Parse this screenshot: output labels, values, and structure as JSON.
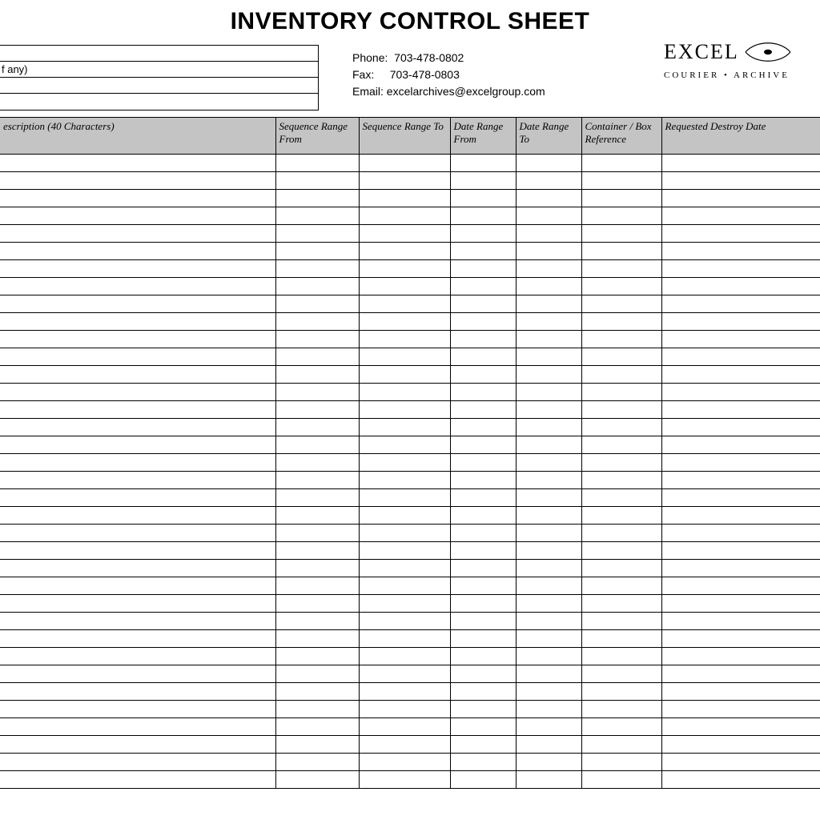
{
  "title": "INVENTORY CONTROL SHEET",
  "info_box": {
    "row1": "",
    "row2": "f any)",
    "row3": "",
    "row4": ""
  },
  "contact": {
    "phone_label": "Phone:",
    "phone": "703-478-0802",
    "fax_label": "Fax:",
    "fax": "703-478-0803",
    "email_label": "Email:",
    "email": "excelarchives@excelgroup.com"
  },
  "logo": {
    "name": "EXCEL",
    "tagline": "COURIER • ARCHIVE"
  },
  "columns": {
    "description": "escription (40 Characters)",
    "seq_from": "Sequence Range From",
    "seq_to": "Sequence Range To",
    "date_from": "Date Range From",
    "date_to": "Date Range To",
    "container": "Container / Box Reference",
    "destroy": "Requested Destroy Date"
  },
  "row_count": 36
}
